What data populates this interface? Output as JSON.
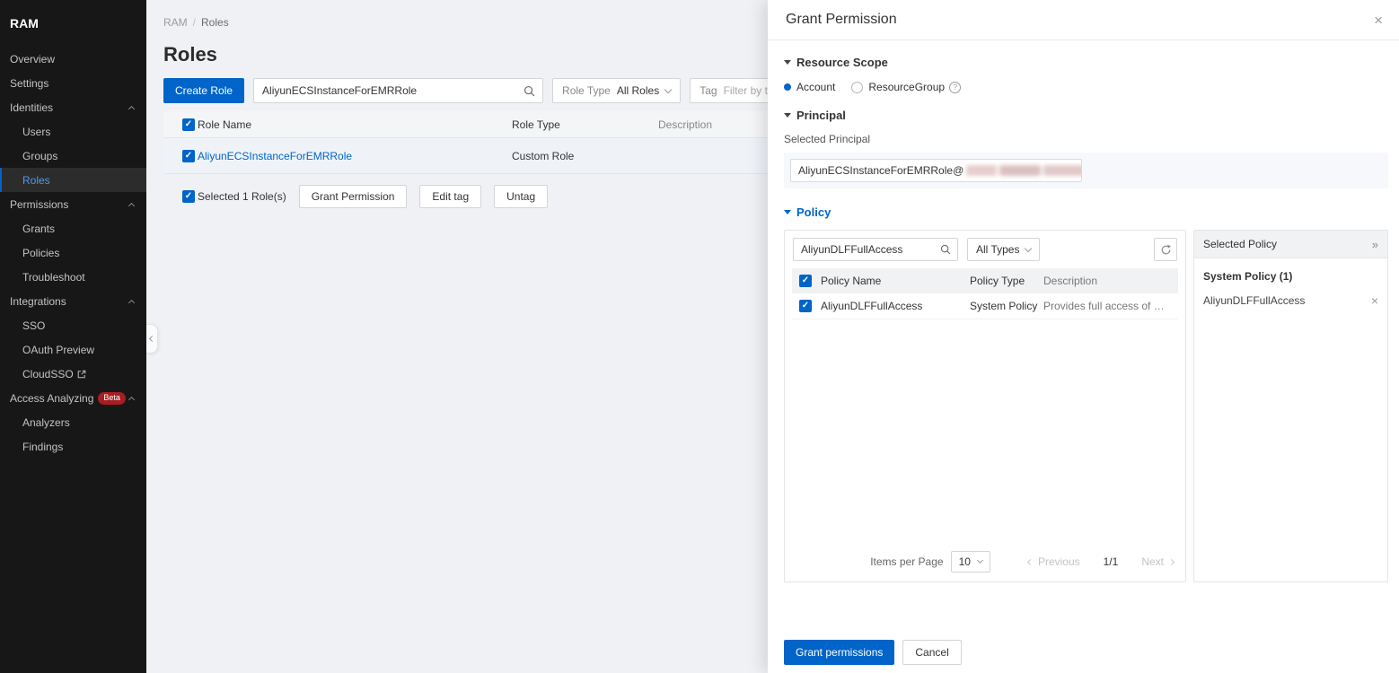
{
  "colors": {
    "accent": "#0064c8",
    "beta_badge": "#a61d24",
    "sidebar_bg": "#171717"
  },
  "sidebar": {
    "app_title": "RAM",
    "items": [
      {
        "label": "Overview"
      },
      {
        "label": "Settings"
      },
      {
        "label": "Identities"
      },
      {
        "label": "Users"
      },
      {
        "label": "Groups"
      },
      {
        "label": "Roles",
        "selected": true
      },
      {
        "label": "Permissions"
      },
      {
        "label": "Grants"
      },
      {
        "label": "Policies"
      },
      {
        "label": "Troubleshoot"
      },
      {
        "label": "Integrations"
      },
      {
        "label": "SSO"
      },
      {
        "label": "OAuth Preview"
      },
      {
        "label": "CloudSSO",
        "external": true
      },
      {
        "label": "Access Analyzing",
        "badge": "Beta"
      },
      {
        "label": "Analyzers"
      },
      {
        "label": "Findings"
      }
    ]
  },
  "breadcrumb": {
    "root": "RAM",
    "separator": "/",
    "current": "Roles"
  },
  "page": {
    "title": "Roles",
    "create_button": "Create Role",
    "search_value": "AliyunECSInstanceForEMRRole",
    "role_type_label": "Role Type",
    "role_type_value": "All Roles",
    "tag_label": "Tag",
    "tag_placeholder": "Filter by tag",
    "table": {
      "headers": {
        "name": "Role Name",
        "type": "Role Type",
        "description": "Description"
      },
      "rows": [
        {
          "name": "AliyunECSInstanceForEMRRole",
          "type": "Custom Role",
          "description": ""
        }
      ]
    },
    "selection_text": "Selected 1 Role(s)",
    "actions": {
      "grant": "Grant Permission",
      "edit_tag": "Edit tag",
      "untag": "Untag"
    }
  },
  "drawer": {
    "title": "Grant Permission",
    "resource_scope": {
      "title": "Resource Scope",
      "account_label": "Account",
      "resource_group_label": "ResourceGroup"
    },
    "principal": {
      "title": "Principal",
      "label": "Selected Principal",
      "value_prefix": "AliyunECSInstanceForEMRRole@",
      "redacted": true,
      "value_suffix": "..."
    },
    "policy": {
      "title": "Policy",
      "search_value": "AliyunDLFFullAccess",
      "type_filter_value": "All Types",
      "headers": {
        "name": "Policy Name",
        "type": "Policy Type",
        "description": "Description"
      },
      "rows": [
        {
          "name": "AliyunDLFFullAccess",
          "type": "System Policy",
          "description": "Provides full access of OpenAPI ..."
        }
      ],
      "pagination": {
        "label": "Items per Page",
        "page_size": "10",
        "previous": "Previous",
        "page_indicator": "1/1",
        "next": "Next"
      }
    },
    "selected_policy": {
      "title": "Selected Policy",
      "group_title": "System Policy (1)",
      "items": [
        {
          "name": "AliyunDLFFullAccess"
        }
      ]
    },
    "footer": {
      "confirm": "Grant permissions",
      "cancel": "Cancel"
    }
  }
}
